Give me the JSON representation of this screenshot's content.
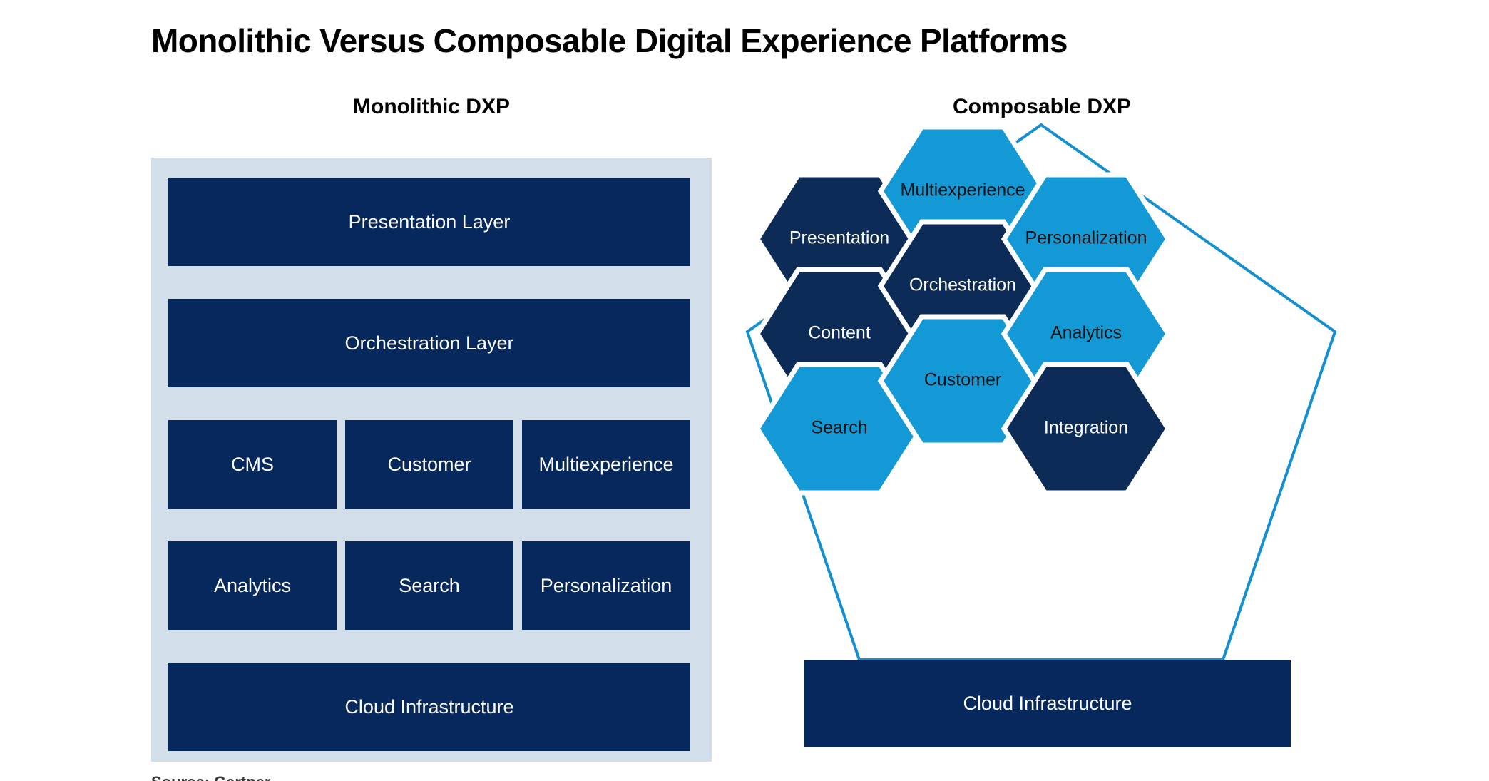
{
  "title": "Monolithic Versus Composable Digital Experience Platforms",
  "columns": {
    "left_heading": "Monolithic DXP",
    "right_heading": "Composable DXP"
  },
  "monolithic": {
    "presentation_layer": "Presentation Layer",
    "orchestration_layer": "Orchestration Layer",
    "grid_row_1": [
      "CMS",
      "Customer",
      "Multiexperience"
    ],
    "grid_row_2": [
      "Analytics",
      "Search",
      "Personalization"
    ],
    "cloud_infrastructure": "Cloud Infrastructure"
  },
  "composable": {
    "hexagons": [
      {
        "label": "Multiexperience",
        "tone": "light"
      },
      {
        "label": "Presentation",
        "tone": "dark"
      },
      {
        "label": "Personalization",
        "tone": "light"
      },
      {
        "label": "Orchestration",
        "tone": "dark"
      },
      {
        "label": "Content",
        "tone": "dark"
      },
      {
        "label": "Analytics",
        "tone": "light"
      },
      {
        "label": "Customer",
        "tone": "light"
      },
      {
        "label": "Search",
        "tone": "light"
      },
      {
        "label": "Integration",
        "tone": "dark"
      }
    ],
    "cloud_infrastructure": "Cloud Infrastructure"
  },
  "source_caption": "Source: Gartner",
  "colors": {
    "navy": "#06285c",
    "light_blue": "#0b94d5",
    "panel_bg": "#d2dfea",
    "page_bg": "#ffffff",
    "title_text": "#000000",
    "hex_gap": "#ffffff"
  },
  "chart_data": {
    "type": "diagram",
    "title": "Monolithic Versus Composable Digital Experience Platforms",
    "panels": [
      {
        "name": "Monolithic DXP",
        "representation": "stacked rectangular layers inside a shaded container",
        "layers": [
          {
            "row": 1,
            "cells": [
              "Presentation Layer"
            ]
          },
          {
            "row": 2,
            "cells": [
              "Orchestration Layer"
            ]
          },
          {
            "row": 3,
            "cells": [
              "CMS",
              "Customer",
              "Multiexperience"
            ]
          },
          {
            "row": 4,
            "cells": [
              "Analytics",
              "Search",
              "Personalization"
            ]
          },
          {
            "row": 5,
            "cells": [
              "Cloud Infrastructure"
            ]
          }
        ]
      },
      {
        "name": "Composable DXP",
        "representation": "honeycomb of nine hexagonal capabilities inside a pentagon outline, over a cloud infrastructure bar",
        "hexagons": [
          "Multiexperience",
          "Presentation",
          "Personalization",
          "Orchestration",
          "Content",
          "Analytics",
          "Customer",
          "Search",
          "Integration"
        ],
        "base": "Cloud Infrastructure"
      }
    ]
  }
}
